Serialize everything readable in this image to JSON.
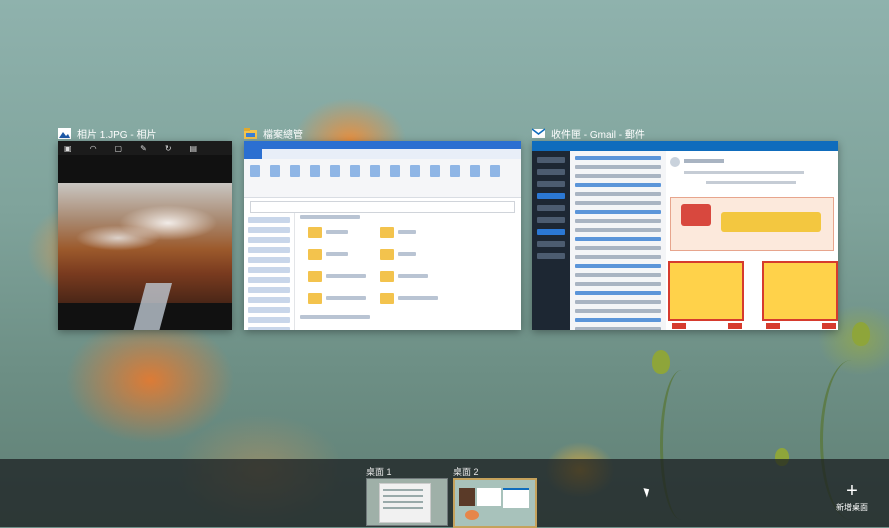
{
  "windows": [
    {
      "title": "相片 1.JPG - 相片",
      "icon": "photos-icon"
    },
    {
      "title": "檔案總管",
      "icon": "file-explorer-icon"
    },
    {
      "title": "收件匣 - Gmail - 郵件",
      "icon": "mail-icon"
    }
  ],
  "desktops": [
    {
      "label": "桌面 1"
    },
    {
      "label": "桌面 2"
    }
  ],
  "new_desktop": {
    "icon": "+",
    "label": "新增桌面"
  },
  "colors": {
    "task_bar": "#1c1e20",
    "accent_blue": "#2b6fd1",
    "desktop2_border": "#c5a25c"
  }
}
